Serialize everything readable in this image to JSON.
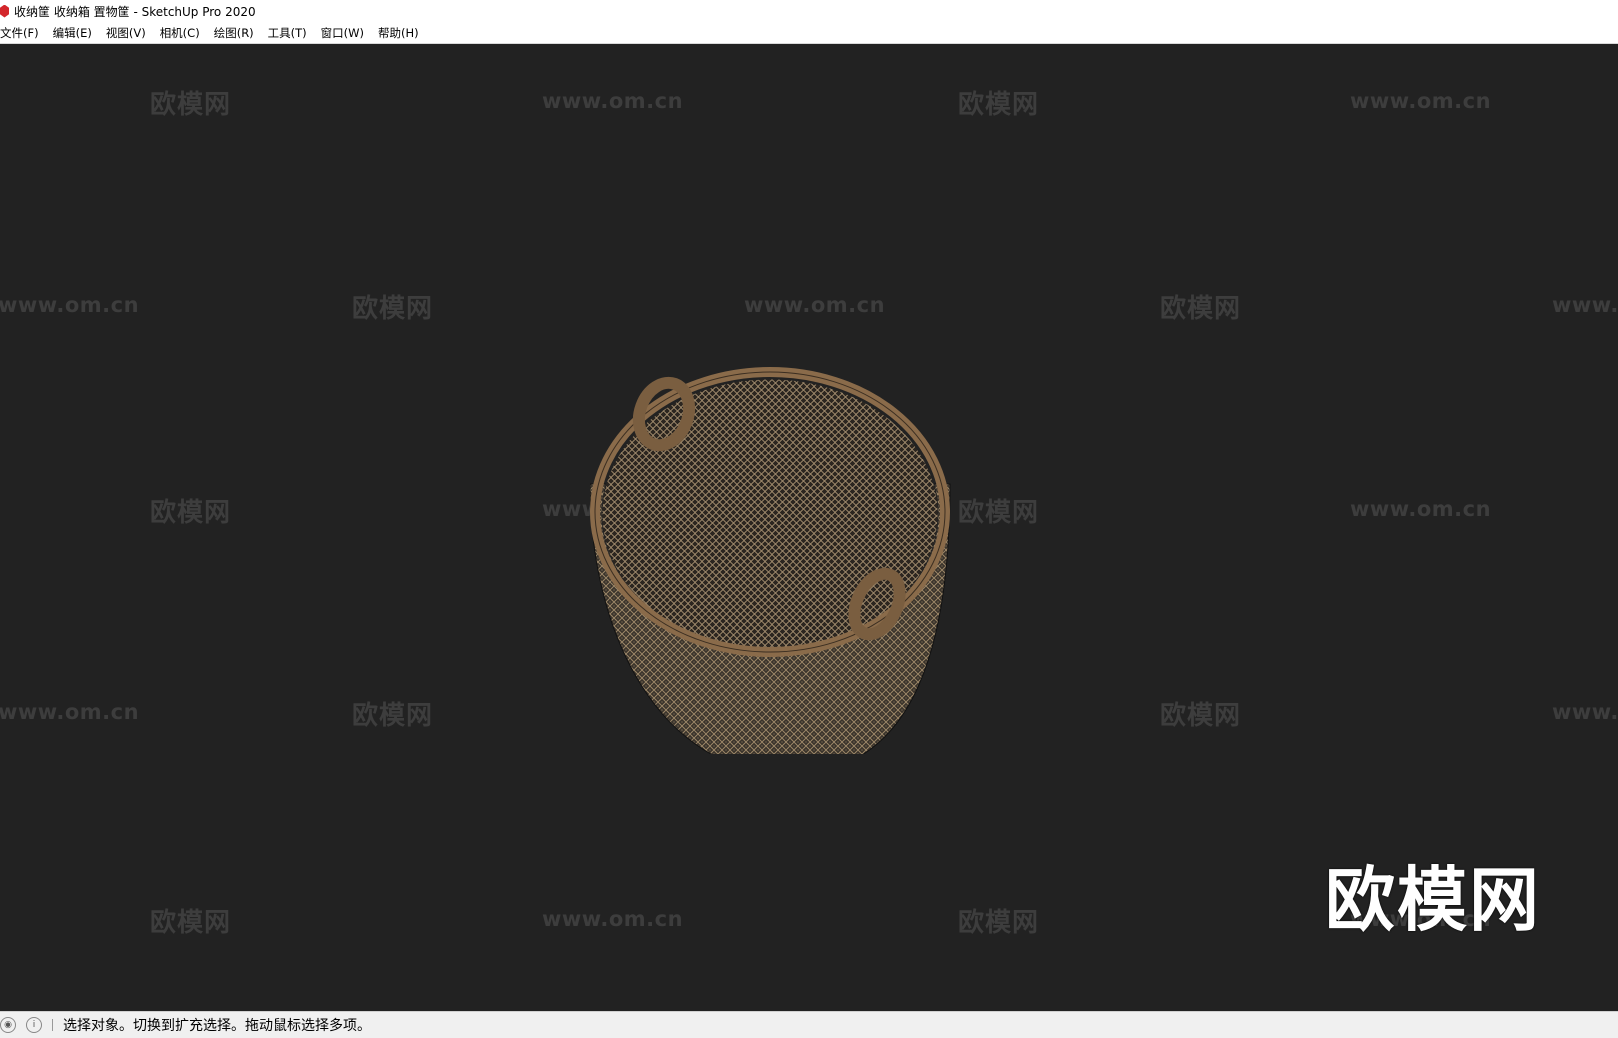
{
  "window": {
    "title": "收纳筐 收纳箱 置物筐 - SketchUp Pro 2020"
  },
  "menu": [
    "文件(F)",
    "编辑(E)",
    "视图(V)",
    "相机(C)",
    "绘图(R)",
    "工具(T)",
    "窗口(W)",
    "帮助(H)"
  ],
  "watermark": {
    "logo": "欧模网",
    "url": "www.om.cn"
  },
  "status": {
    "message": "选择对象。切换到扩充选择。拖动鼠标选择多项。"
  }
}
